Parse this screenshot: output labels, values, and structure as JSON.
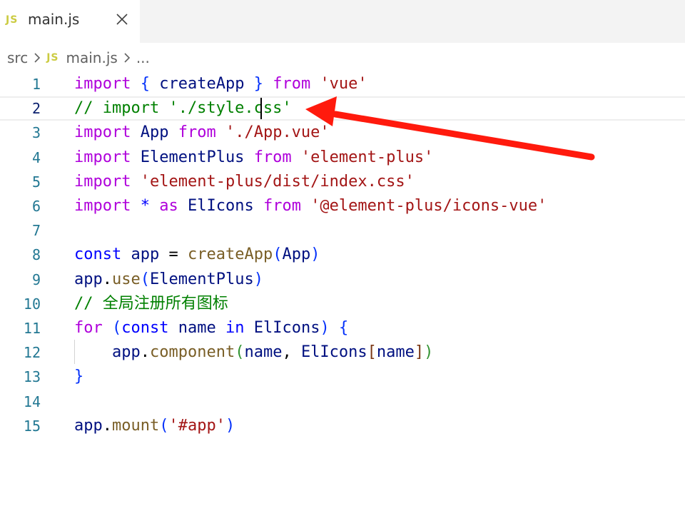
{
  "tab": {
    "badge": "JS",
    "label": "main.js"
  },
  "breadcrumb": {
    "folder": "src",
    "badge": "JS",
    "file": "main.js",
    "more": "..."
  },
  "editor": {
    "line_numbers": [
      "1",
      "2",
      "3",
      "4",
      "5",
      "6",
      "7",
      "8",
      "9",
      "10",
      "11",
      "12",
      "13",
      "14",
      "15"
    ],
    "lines": [
      [
        [
          "kw",
          "import"
        ],
        [
          "pun",
          " "
        ],
        [
          "b1",
          "{"
        ],
        [
          "pun",
          " "
        ],
        [
          "var",
          "createApp"
        ],
        [
          "pun",
          " "
        ],
        [
          "b1",
          "}"
        ],
        [
          "pun",
          " "
        ],
        [
          "kw",
          "from"
        ],
        [
          "pun",
          " "
        ],
        [
          "str",
          "'vue'"
        ]
      ],
      [
        [
          "cm",
          "// import './style.css'"
        ]
      ],
      [
        [
          "kw",
          "import"
        ],
        [
          "pun",
          " "
        ],
        [
          "var",
          "App"
        ],
        [
          "pun",
          " "
        ],
        [
          "kw",
          "from"
        ],
        [
          "pun",
          " "
        ],
        [
          "str",
          "'./App.vue'"
        ]
      ],
      [
        [
          "kw",
          "import"
        ],
        [
          "pun",
          " "
        ],
        [
          "var",
          "ElementPlus"
        ],
        [
          "pun",
          " "
        ],
        [
          "kw",
          "from"
        ],
        [
          "pun",
          " "
        ],
        [
          "str",
          "'element-plus'"
        ]
      ],
      [
        [
          "kw",
          "import"
        ],
        [
          "pun",
          " "
        ],
        [
          "str",
          "'element-plus/dist/index.css'"
        ]
      ],
      [
        [
          "kw",
          "import"
        ],
        [
          "pun",
          " "
        ],
        [
          "kwb",
          "*"
        ],
        [
          "pun",
          " "
        ],
        [
          "kw",
          "as"
        ],
        [
          "pun",
          " "
        ],
        [
          "var",
          "ElIcons"
        ],
        [
          "pun",
          " "
        ],
        [
          "kw",
          "from"
        ],
        [
          "pun",
          " "
        ],
        [
          "str",
          "'@element-plus/icons-vue'"
        ]
      ],
      [],
      [
        [
          "kwb",
          "const"
        ],
        [
          "pun",
          " "
        ],
        [
          "var",
          "app"
        ],
        [
          "pun",
          " = "
        ],
        [
          "fn",
          "createApp"
        ],
        [
          "b1",
          "("
        ],
        [
          "var",
          "App"
        ],
        [
          "b1",
          ")"
        ]
      ],
      [
        [
          "var",
          "app"
        ],
        [
          "pun",
          "."
        ],
        [
          "fn",
          "use"
        ],
        [
          "b1",
          "("
        ],
        [
          "var",
          "ElementPlus"
        ],
        [
          "b1",
          ")"
        ]
      ],
      [
        [
          "cm",
          "// "
        ],
        [
          "cm cjk",
          "全局注册所有图标"
        ]
      ],
      [
        [
          "kw",
          "for"
        ],
        [
          "pun",
          " "
        ],
        [
          "b1",
          "("
        ],
        [
          "kwb",
          "const"
        ],
        [
          "pun",
          " "
        ],
        [
          "var",
          "name"
        ],
        [
          "pun",
          " "
        ],
        [
          "kwb",
          "in"
        ],
        [
          "pun",
          " "
        ],
        [
          "var",
          "ElIcons"
        ],
        [
          "b1",
          ")"
        ],
        [
          "pun",
          " "
        ],
        [
          "b1",
          "{"
        ]
      ],
      [
        [
          "pun",
          "    "
        ],
        [
          "var",
          "app"
        ],
        [
          "pun",
          "."
        ],
        [
          "fn",
          "component"
        ],
        [
          "b2",
          "("
        ],
        [
          "var",
          "name"
        ],
        [
          "pun",
          ", "
        ],
        [
          "var",
          "ElIcons"
        ],
        [
          "b3",
          "["
        ],
        [
          "var",
          "name"
        ],
        [
          "b3",
          "]"
        ],
        [
          "b2",
          ")"
        ]
      ],
      [
        [
          "b1",
          "}"
        ]
      ],
      [],
      [
        [
          "var",
          "app"
        ],
        [
          "pun",
          "."
        ],
        [
          "fn",
          "mount"
        ],
        [
          "b1",
          "("
        ],
        [
          "str",
          "'#app'"
        ],
        [
          "b1",
          ")"
        ]
      ]
    ]
  },
  "colors": {
    "annotation_arrow": "#ff1a0d",
    "js_badge": "#cbcb41",
    "line_number": "#237893"
  },
  "icons": {
    "tab_close": "close-icon",
    "breadcrumb_separator": "chevron-right-icon"
  }
}
